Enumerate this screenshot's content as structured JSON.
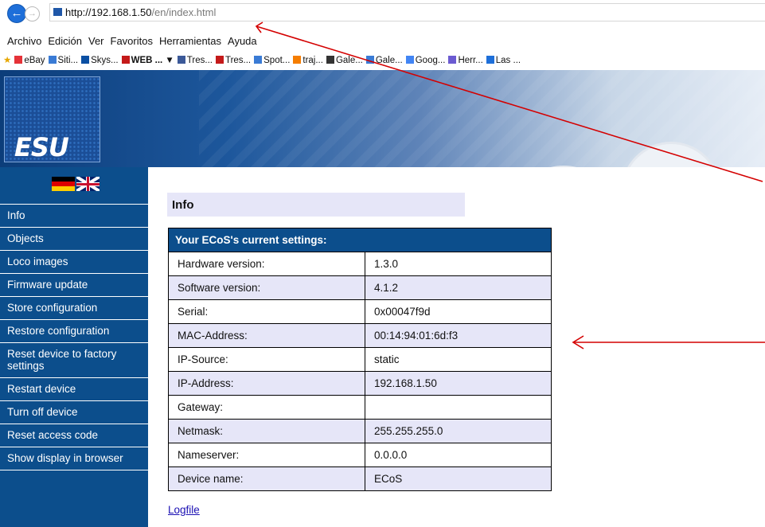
{
  "browser": {
    "address": {
      "host": "http://192.168.1.50",
      "path": "/en/index.html"
    },
    "menu": [
      "Archivo",
      "Edición",
      "Ver",
      "Favoritos",
      "Herramientas",
      "Ayuda"
    ],
    "favorites": [
      {
        "label": "eBay",
        "icon": "ebay-icon",
        "color": "#e53238"
      },
      {
        "label": "Siti...",
        "icon": "ie-page-icon",
        "color": "#3a7bd5"
      },
      {
        "label": "Skys...",
        "icon": "skyscanner-icon",
        "color": "#0a4fa3"
      },
      {
        "label": "WEB ... ▼",
        "icon": "folder-3c-icon",
        "color": "#c41a1a"
      },
      {
        "label": "Tres...",
        "icon": "facebook-icon",
        "color": "#3b5998"
      },
      {
        "label": "Tres...",
        "icon": "folder-3c-icon",
        "color": "#c41a1a"
      },
      {
        "label": "Spot...",
        "icon": "ie-page-icon",
        "color": "#3a7bd5"
      },
      {
        "label": "traj...",
        "icon": "blogger-icon",
        "color": "#f57d00"
      },
      {
        "label": "Gale...",
        "icon": "gallery-icon",
        "color": "#333333"
      },
      {
        "label": "Gale...",
        "icon": "ie-page-icon",
        "color": "#3a7bd5"
      },
      {
        "label": "Goog...",
        "icon": "google-icon",
        "color": "#4285f4"
      },
      {
        "label": "Herr...",
        "icon": "tool-icon",
        "color": "#6b5bd1"
      },
      {
        "label": "Las ...",
        "icon": "plus-icon",
        "color": "#1e6fd9"
      }
    ]
  },
  "banner": {
    "logo_text": "ESU"
  },
  "sidebar": {
    "items": [
      "Info",
      "Objects",
      "Loco images",
      "Firmware update",
      "Store configuration",
      "Restore configuration",
      "Reset device to factory settings",
      "Restart device",
      "Turn off device",
      "Reset access code",
      "Show display in browser"
    ]
  },
  "main": {
    "title": "Info",
    "table": {
      "header": "Your ECoS's current settings:",
      "rows": [
        {
          "key": "Hardware version:",
          "value": "1.3.0"
        },
        {
          "key": "Software version:",
          "value": "4.1.2"
        },
        {
          "key": "Serial:",
          "value": "0x00047f9d"
        },
        {
          "key": "MAC-Address:",
          "value": "00:14:94:01:6d:f3"
        },
        {
          "key": "IP-Source:",
          "value": "static"
        },
        {
          "key": "IP-Address:",
          "value": "192.168.1.50"
        },
        {
          "key": "Gateway:",
          "value": ""
        },
        {
          "key": "Netmask:",
          "value": "255.255.255.0"
        },
        {
          "key": "Nameserver:",
          "value": "0.0.0.0"
        },
        {
          "key": "Device name:",
          "value": "ECoS"
        }
      ]
    },
    "logfile_label": "Logfile"
  },
  "colors": {
    "sidebar_bg": "#0c4e8c",
    "table_header_bg": "#0c4e8c",
    "row_alt_bg": "#e6e6f8",
    "annotation_arrow": "#d40000"
  }
}
